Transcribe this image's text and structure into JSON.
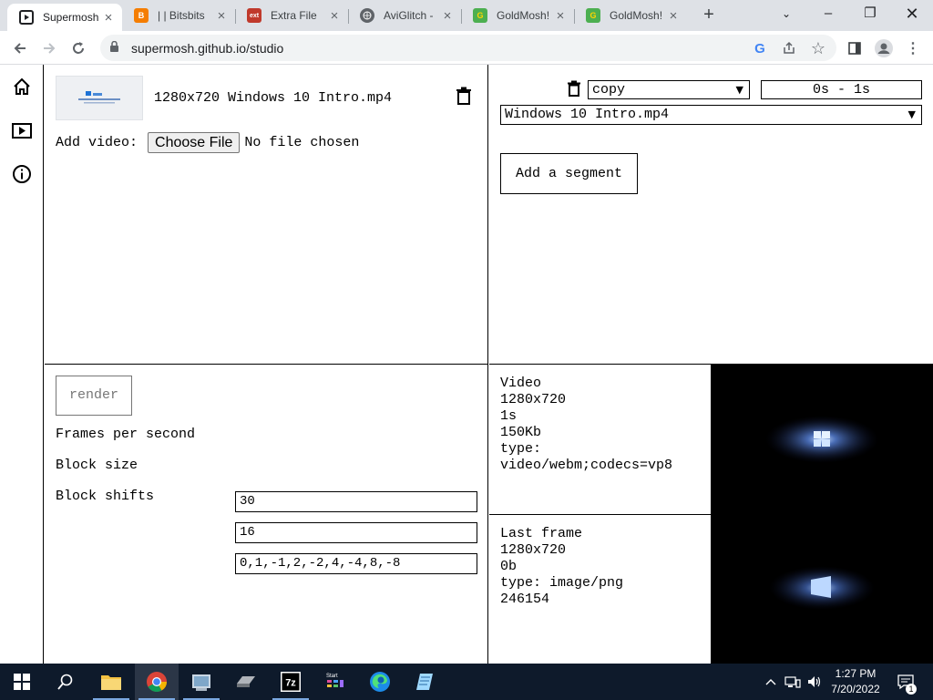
{
  "browser": {
    "tabs": [
      {
        "title": "Supermosh",
        "active": true,
        "favicon": "play-box-icon"
      },
      {
        "title": "| | Bitsbits",
        "active": false,
        "favicon": "blogger-icon"
      },
      {
        "title": "Extra File",
        "active": false,
        "favicon": "ext-icon"
      },
      {
        "title": "AviGlitch -",
        "active": false,
        "favicon": "globe-icon"
      },
      {
        "title": "GoldMosh!",
        "active": false,
        "favicon": "goldmosh-icon"
      },
      {
        "title": "GoldMosh!",
        "active": false,
        "favicon": "goldmosh-icon"
      }
    ],
    "url": "supermosh.github.io/studio"
  },
  "videos_pane": {
    "video_name": "1280x720 Windows 10 Intro.mp4",
    "add_video_label": "Add video:",
    "choose_file_label": "Choose File",
    "no_file_text": "No file chosen"
  },
  "segments_pane": {
    "mode_value": "copy",
    "time_range": "0s - 1s",
    "source_value": "Windows 10 Intro.mp4",
    "add_segment_label": "Add a segment"
  },
  "render_pane": {
    "render_label": "render",
    "fps_label": "Frames per second",
    "fps_value": "30",
    "block_size_label": "Block size",
    "block_size_value": "16",
    "block_shifts_label": "Block shifts",
    "block_shifts_value": "0,1,-1,2,-2,4,-4,8,-8"
  },
  "info_pane": {
    "video": {
      "heading": "Video",
      "resolution": "1280x720",
      "duration": "1s",
      "size": "150Kb",
      "type_label": "type:",
      "type_value": "video/webm;codecs=vp8"
    },
    "last_frame": {
      "heading": "Last frame",
      "resolution": "1280x720",
      "size": "0b",
      "type": "type: image/png",
      "number": "246154"
    }
  },
  "taskbar": {
    "time": "1:27 PM",
    "date": "7/20/2022",
    "notification_count": "1"
  },
  "colors": {
    "accent_blue": "#1a73e8",
    "taskbar_bg": "#0e1a2b",
    "tab_strip_bg": "#dee1e6"
  }
}
